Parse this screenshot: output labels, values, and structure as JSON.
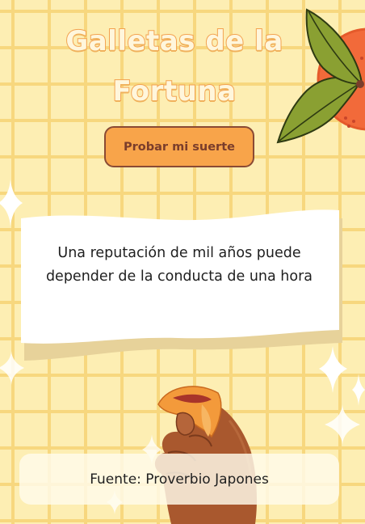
{
  "title": "Galletas de la Fortuna",
  "button": {
    "label": "Probar mi suerte"
  },
  "fortune": {
    "text": "Una reputación de mil años puede depender de la conducta de una hora"
  },
  "source": {
    "label": "Fuente:",
    "value": "Proverbio Japones",
    "full": "Fuente: Proverbio Japones"
  },
  "colors": {
    "background": "#fdeeb3",
    "grid": "#f7d77e",
    "title_fill": "#fff6dc",
    "title_outline": "#f3a24f",
    "button_fill": "#f8a44a",
    "button_border": "#8a4a34",
    "button_text": "#7a3d2b",
    "orange": "#f26a3a",
    "leaf": "#8aa032",
    "hand": "#a9582e"
  },
  "icons": [
    "orange-fruit-icon",
    "leaf-icon",
    "sparkle-icon",
    "hand-holding-cookie-icon",
    "fortune-cookie-icon"
  ]
}
